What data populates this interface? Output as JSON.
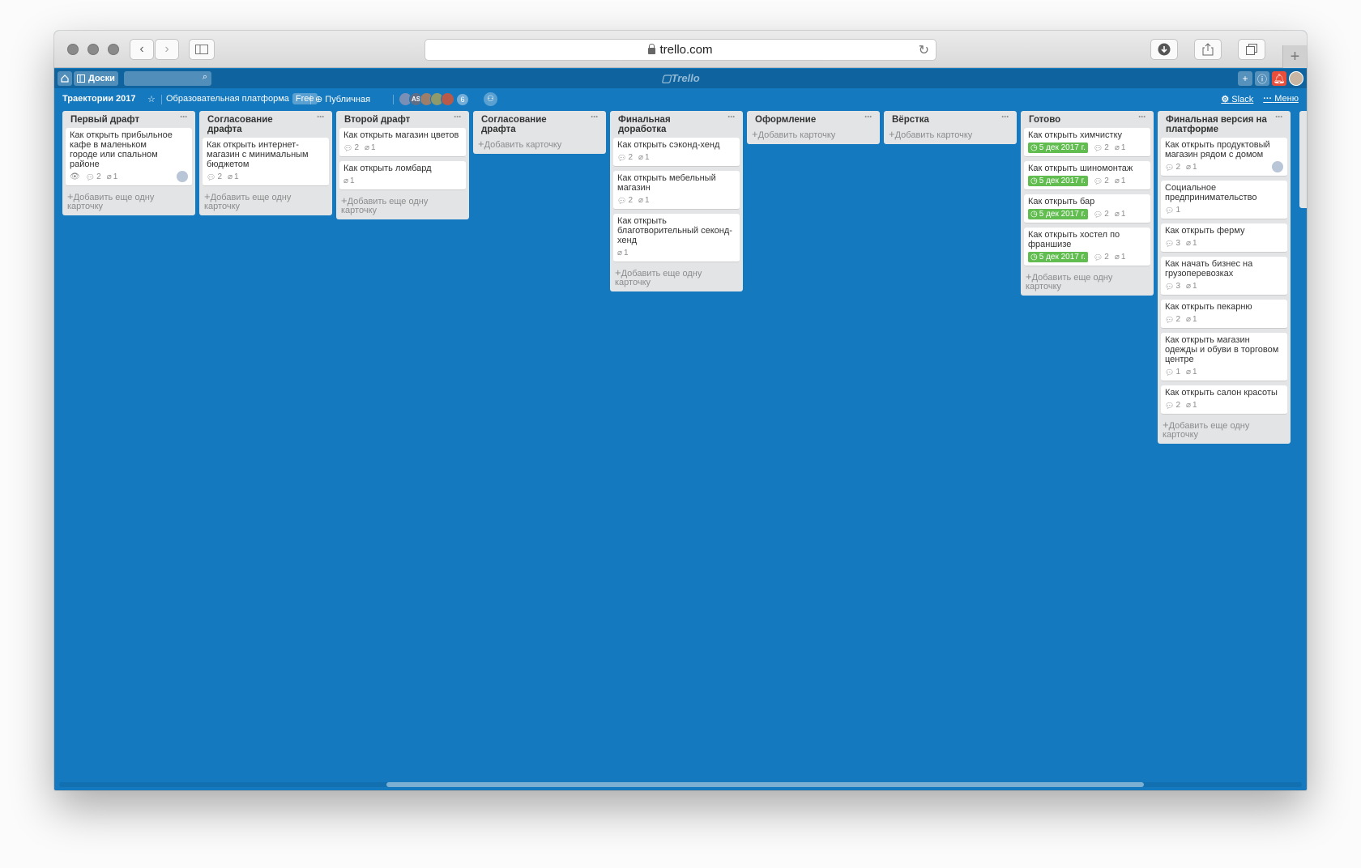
{
  "browser": {
    "url": "trello.com"
  },
  "header": {
    "boards_label": "Доски",
    "logo": "Trello"
  },
  "board": {
    "title": "Траектории 2017",
    "team": "Образовательная платформа",
    "plan": "Free",
    "visibility": "Публичная",
    "members_count": "6",
    "member_initials": "AS",
    "slack": "Slack",
    "menu": "Меню"
  },
  "add_card_label": "Добавить еще одну карточку",
  "add_card_first": "Добавить карточку",
  "lists": [
    {
      "name": "Первый драфт",
      "cards": [
        {
          "title": "Как открыть прибыльное кафе в маленьком городе или спальном районе",
          "watch": true,
          "comments": "2",
          "attachments": "1",
          "avatar": true
        }
      ]
    },
    {
      "name": "Согласование драфта",
      "cards": [
        {
          "title": "Как открыть интернет-магазин с минимальным бюджетом",
          "comments": "2",
          "attachments": "1"
        }
      ]
    },
    {
      "name": "Второй драфт",
      "cards": [
        {
          "title": "Как открыть магазин цветов",
          "comments": "2",
          "attachments": "1"
        },
        {
          "title": "Как открыть ломбард",
          "attachments": "1"
        }
      ]
    },
    {
      "name": "Согласование драфта",
      "cards": []
    },
    {
      "name": "Финальная доработка",
      "cards": [
        {
          "title": "Как открыть сэконд-хенд",
          "comments": "2",
          "attachments": "1"
        },
        {
          "title": "Как открыть мебельный магазин",
          "comments": "2",
          "attachments": "1"
        },
        {
          "title": "Как открыть благотворительный секонд-хенд",
          "attachments": "1"
        }
      ]
    },
    {
      "name": "Оформление",
      "cards": []
    },
    {
      "name": "Вёрстка",
      "cards": []
    },
    {
      "name": "Готово",
      "cards": [
        {
          "title": "Как открыть химчистку",
          "due": "5 дек 2017 г.",
          "comments": "2",
          "attachments": "1"
        },
        {
          "title": "Как открыть шиномонтаж",
          "due": "5 дек 2017 г.",
          "comments": "2",
          "attachments": "1"
        },
        {
          "title": "Как открыть бар",
          "due": "5 дек 2017 г.",
          "comments": "2",
          "attachments": "1"
        },
        {
          "title": "Как открыть хостел по франшизе",
          "due": "5 дек 2017 г.",
          "comments": "2",
          "attachments": "1"
        }
      ]
    },
    {
      "name": "Финальная версия на платформе",
      "cards": [
        {
          "title": "Как открыть продуктовый магазин рядом с домом",
          "comments": "2",
          "attachments": "1",
          "avatar": true
        },
        {
          "title": "Социальное предпринимательство",
          "comments": "1"
        },
        {
          "title": "Как открыть ферму",
          "comments": "3",
          "attachments": "1"
        },
        {
          "title": "Как начать бизнес на грузоперевозках",
          "comments": "3",
          "attachments": "1"
        },
        {
          "title": "Как открыть пекарню",
          "comments": "2",
          "attachments": "1"
        },
        {
          "title": "Как открыть магазин одежды и обуви в торговом центре",
          "comments": "1",
          "attachments": "1"
        },
        {
          "title": "Как открыть салон красоты",
          "comments": "2",
          "attachments": "1"
        }
      ]
    }
  ]
}
